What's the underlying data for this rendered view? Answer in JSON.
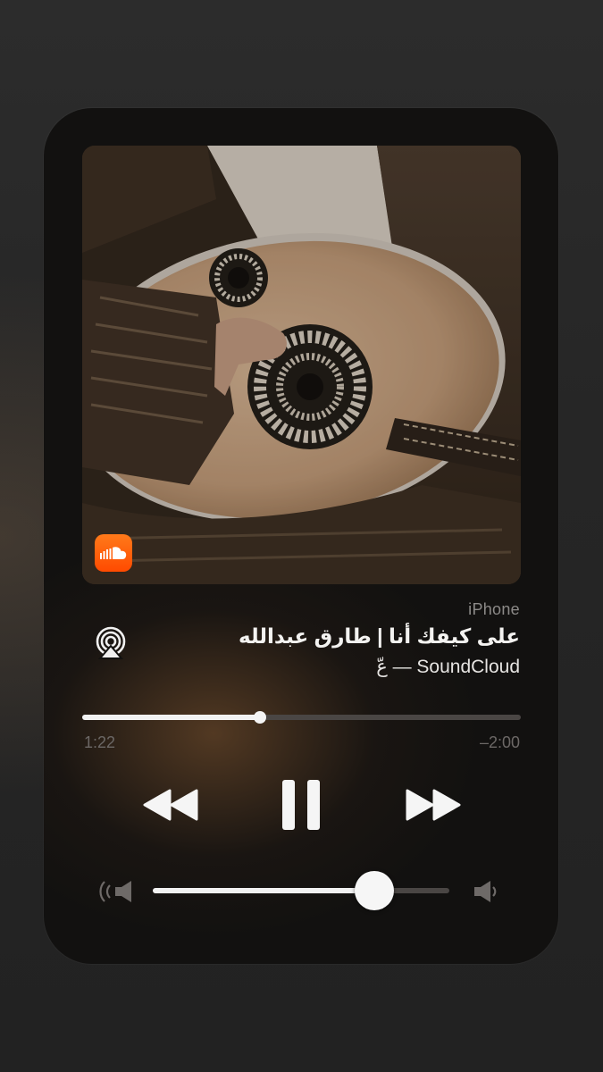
{
  "player": {
    "artwork_icon": "oud-album-artwork",
    "source_badge_icon": "soundcloud-icon",
    "device": "iPhone",
    "title": "على كيفك أنا | طارق عبدالله",
    "subtitle": "عّ — SoundCloud",
    "airplay_icon": "airplay-icon",
    "elapsed": "1:22",
    "remaining": "–2:00",
    "progress_fraction": 0.406,
    "volume_fraction": 0.747
  },
  "controls": {
    "rewind_icon": "rewind-icon",
    "pause_icon": "pause-icon",
    "forward_icon": "fast-forward-icon",
    "volume_low_icon": "volume-low-icon",
    "volume_high_icon": "volume-high-icon"
  },
  "colors": {
    "accent": "#ff5500",
    "background": "#262626",
    "card": "#121110"
  }
}
